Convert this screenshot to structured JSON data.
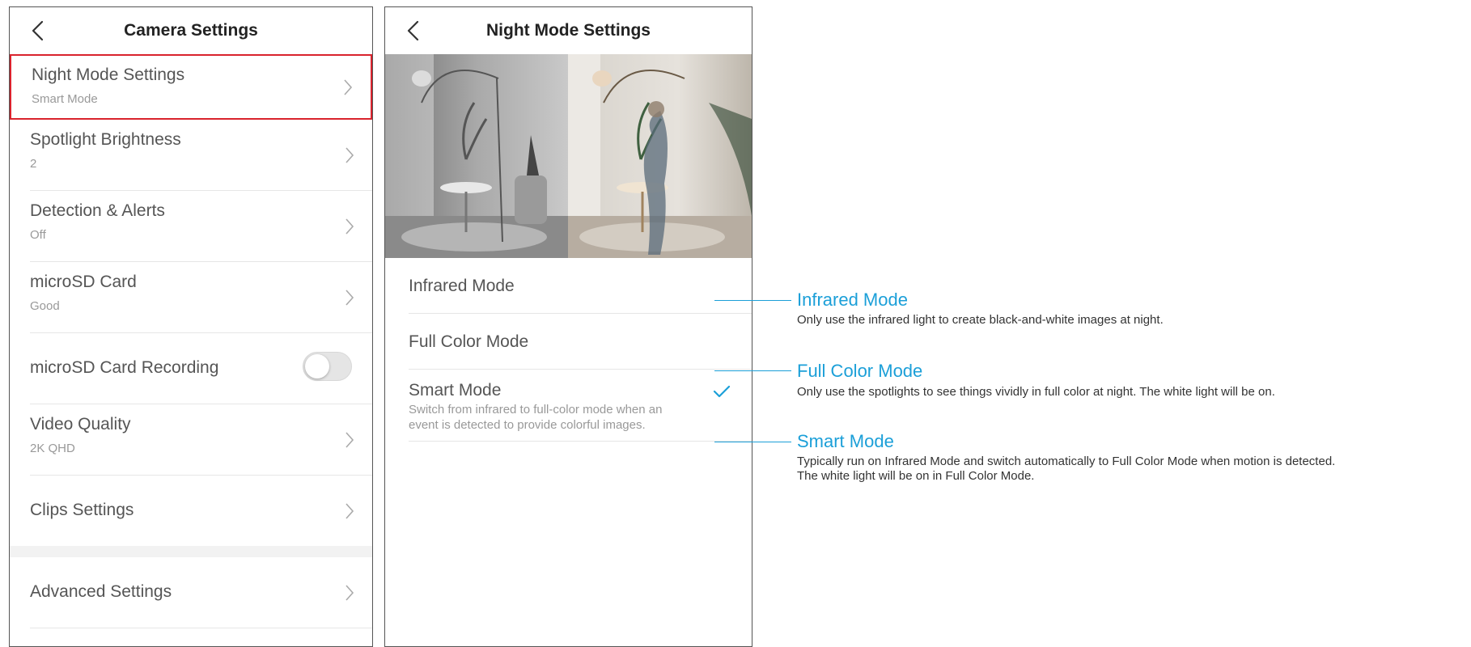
{
  "left_screen": {
    "title": "Camera Settings",
    "items": [
      {
        "label": "Night Mode Settings",
        "value": "Smart Mode"
      },
      {
        "label": "Spotlight Brightness",
        "value": "2"
      },
      {
        "label": "Detection & Alerts",
        "value": "Off"
      },
      {
        "label": "microSD Card",
        "value": "Good"
      },
      {
        "label": "microSD Card Recording",
        "toggle_on": false
      },
      {
        "label": "Video Quality",
        "value": "2K QHD"
      },
      {
        "label": "Clips Settings"
      },
      {
        "label": "Advanced Settings"
      }
    ]
  },
  "right_screen": {
    "title": "Night Mode Settings",
    "modes": [
      {
        "label": "Infrared Mode",
        "selected": false
      },
      {
        "label": "Full Color Mode",
        "selected": false
      },
      {
        "label": "Smart Mode",
        "selected": true,
        "description_line1": "Switch from infrared to full-color mode when an",
        "description_line2": "event is detected to provide colorful images."
      }
    ]
  },
  "annotations": [
    {
      "title": "Infrared Mode",
      "text": "Only use the infrared light to create black-and-white images at night."
    },
    {
      "title": "Full Color Mode",
      "text": "Only use the spotlights to see things vividly in full color at night. The white light will be on."
    },
    {
      "title": "Smart Mode",
      "text_line1": "Typically run on Infrared Mode and switch automatically to Full Color Mode when motion is detected.",
      "text_line2": "The white light will be on in Full Color Mode."
    }
  ],
  "colors": {
    "highlight_border": "#d9232d",
    "accent_blue": "#1b9fd8",
    "check_blue": "#1b9fd8"
  }
}
